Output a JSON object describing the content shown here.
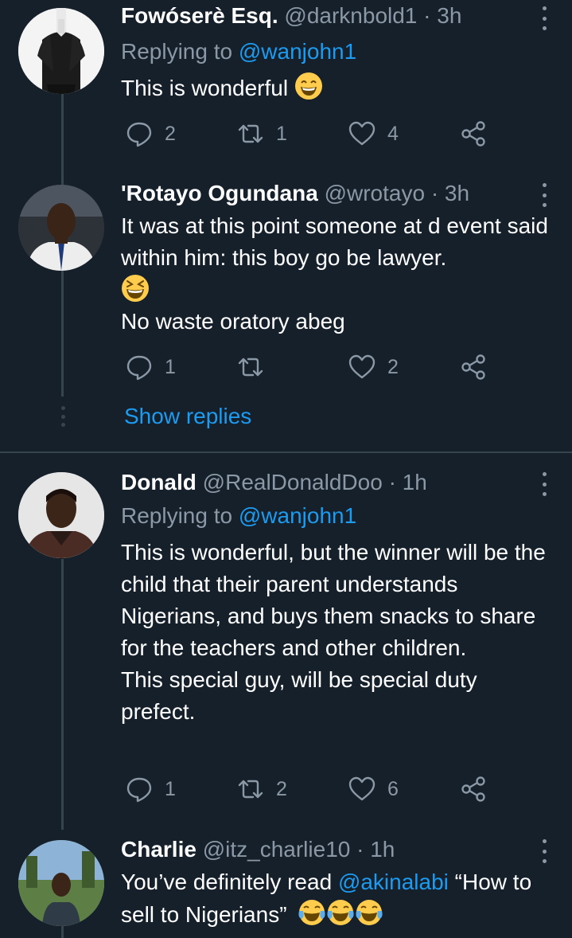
{
  "tweets": [
    {
      "name": "Fowóserè Esq.",
      "handle": "@darknbold1",
      "time": "3h",
      "replying_prefix": "Replying to ",
      "replying_to": "@wanjohn1",
      "text": "This is wonderful",
      "replies": "2",
      "retweets": "1",
      "likes": "4"
    },
    {
      "name": "'Rotayo Ogundana",
      "handle": "@wrotayo",
      "time": "3h",
      "text_line1": "It was at this point someone at d event said within him: this boy go be lawyer.",
      "text_line2": "No waste oratory abeg",
      "replies": "1",
      "retweets": "",
      "likes": "2"
    },
    {
      "name": "Donald",
      "handle": "@RealDonaldDoo",
      "time": "1h",
      "replying_prefix": "Replying to ",
      "replying_to": "@wanjohn1",
      "text_line1": "This is wonderful, but the winner will be the child that their parent understands Nigerians, and buys them snacks to share for the teachers and other children.",
      "text_line2": "This special guy, will be special duty prefect.",
      "replies": "1",
      "retweets": "2",
      "likes": "6"
    },
    {
      "name": "Charlie",
      "handle": "@itz_charlie10",
      "time": "1h",
      "text_pre": "You’ve definitely read ",
      "text_mention": "@akinalabi",
      "text_post": " “How to sell to Nigerians”"
    }
  ],
  "separator": "·",
  "show_replies": "Show replies",
  "colors": {
    "background": "#15202b",
    "accent": "#1d9bf0",
    "secondary_text": "#8b98a5",
    "line": "#38444d"
  },
  "icons": {
    "reply": "speech-bubble-icon",
    "retweet": "retweet-arrows-icon",
    "like": "heart-icon",
    "share": "share-nodes-icon",
    "more": "vertical-dots-icon"
  }
}
